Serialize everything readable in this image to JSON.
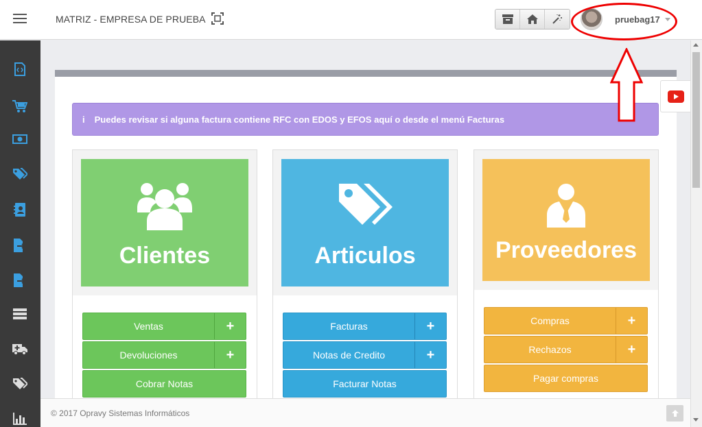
{
  "header": {
    "company": "MATRIZ - EMPRESA DE PRUEBA",
    "username": "pruebag17",
    "toolbar_icons": [
      "archive-icon",
      "home-icon",
      "magic-wand-icon"
    ]
  },
  "sidebar": {
    "items": [
      "code-file-icon",
      "cart-icon",
      "money-icon",
      "tags-icon",
      "address-book-icon",
      "export-file-icon",
      "export-file-icon",
      "list-icon",
      "ambulance-icon",
      "tags-icon",
      "bar-chart-icon"
    ]
  },
  "alert": {
    "icon": "i",
    "text": "Puedes revisar si alguna factura contiene RFC con EDOS y EFOS aquí o desde el menú Facturas"
  },
  "cards": {
    "clientes": {
      "title": "Clientes",
      "color": "#80cf72",
      "buttons": {
        "ventas": "Ventas",
        "devoluciones": "Devoluciones",
        "cobrar": "Cobrar Notas"
      }
    },
    "articulos": {
      "title": "Articulos",
      "color": "#4fb6e1",
      "buttons": {
        "facturas": "Facturas",
        "notas_credito": "Notas de Credito",
        "facturar": "Facturar Notas"
      }
    },
    "proveedores": {
      "title": "Proveedores",
      "color": "#f5c15a",
      "buttons": {
        "compras": "Compras",
        "rechazos": "Rechazos",
        "pagar": "Pagar compras"
      }
    }
  },
  "plus_symbol": "+",
  "footer": {
    "text": "© 2017 Opravy Sistemas Informáticos"
  },
  "colors": {
    "sidebar": "#3a3a3a",
    "sidebar_icon": "#3b9fe0",
    "annotation": "#ee0000",
    "alert": "#b097e6"
  }
}
